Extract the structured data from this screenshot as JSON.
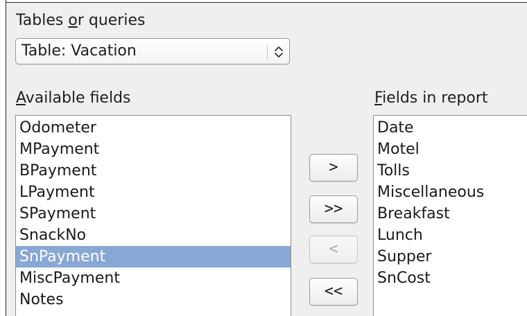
{
  "source_section": {
    "label_pre": "Tables ",
    "label_mnemonic": "o",
    "label_post": "r queries",
    "selected_value": "Table: Vacation"
  },
  "available_fields": {
    "label_mnemonic": "A",
    "label_post": "vailable fields",
    "items": [
      "Odometer",
      "MPayment",
      "BPayment",
      "LPayment",
      "SPayment",
      "SnackNo",
      "SnPayment",
      "MiscPayment",
      "Notes"
    ],
    "selected_item": "SnPayment"
  },
  "fields_in_report": {
    "label_mnemonic": "F",
    "label_post": "ields in report",
    "items": [
      "Date",
      "Motel",
      "Tolls",
      "Miscellaneous",
      "Breakfast",
      "Lunch",
      "Supper",
      "SnCost"
    ]
  },
  "transfer_buttons": {
    "add_one": ">",
    "add_all": ">>",
    "remove_one": "<",
    "remove_all": "<<",
    "remove_one_enabled": false
  },
  "icons": {
    "combo_spinner": "up-down-chevron-icon"
  }
}
